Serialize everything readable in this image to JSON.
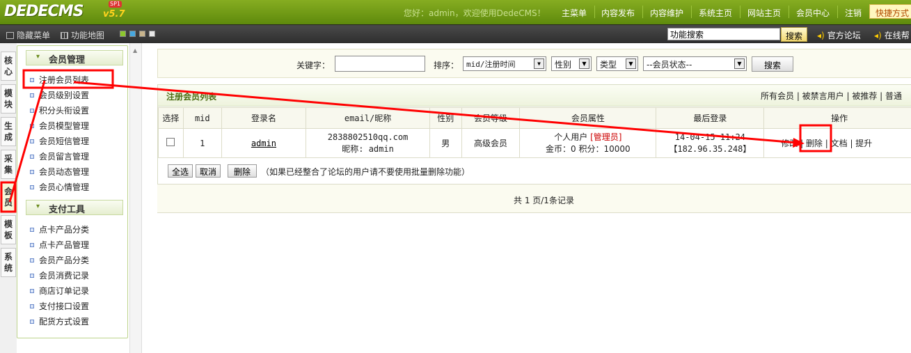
{
  "header": {
    "logo": "DEDECMS",
    "version": "v5.7",
    "edition": "SP1",
    "welcome": "您好：admin，欢迎使用DedeCMS！",
    "nav": [
      "主菜单",
      "内容发布",
      "内容维护",
      "系统主页",
      "网站主页",
      "会员中心",
      "注销"
    ],
    "shortcut": "快捷方式"
  },
  "toolbar": {
    "hide_menu": "隐藏菜单",
    "site_map": "功能地图",
    "skin_colors": [
      "#8ec82e",
      "#47a8e0",
      "#c8b48c",
      "#e8e8e8"
    ],
    "search_value": "功能搜索",
    "search_button": "搜索",
    "forum_link": "官方论坛",
    "help_link": "在线帮"
  },
  "vtabs": [
    {
      "label": "核\n心",
      "active": false
    },
    {
      "label": "模\n块",
      "active": false
    },
    {
      "label": "生\n成",
      "active": false
    },
    {
      "label": "采\n集",
      "active": false
    },
    {
      "label": "会\n员",
      "active": true
    },
    {
      "label": "模\n板",
      "active": false
    },
    {
      "label": "系\n统",
      "active": false
    }
  ],
  "sidebar": {
    "sections": [
      {
        "title": "会员管理",
        "items": [
          "注册会员列表",
          "会员级别设置",
          "积分头衔设置",
          "会员模型管理",
          "会员短信管理",
          "会员留言管理",
          "会员动态管理",
          "会员心情管理"
        ]
      },
      {
        "title": "支付工具",
        "items": [
          "点卡产品分类",
          "点卡产品管理",
          "会员产品分类",
          "会员消费记录",
          "商店订单记录",
          "支付接口设置",
          "配货方式设置"
        ]
      }
    ]
  },
  "search": {
    "keyword_label": "关键字：",
    "keyword_value": "",
    "sort_label": "排序：",
    "sort_value": "mid/注册时间",
    "gender_value": "性别",
    "type_value": "类型",
    "status_value": "--会员状态--",
    "button": "搜索"
  },
  "list": {
    "title": "注册会员列表",
    "filters": "所有会员 | 被禁言用户 | 被推荐 | 普通",
    "columns": [
      "选择",
      "mid",
      "登录名",
      "email/昵称",
      "性别",
      "会员等级",
      "会员属性",
      "最后登录",
      "操作"
    ],
    "rows": [
      {
        "mid": "1",
        "username": "admin",
        "email": "2838802510qq.com",
        "nickname": "昵称: admin",
        "gender": "男",
        "level": "高级会员",
        "attr_type": "个人用户",
        "attr_role": "[管理员]",
        "attr_points": "金币：0 积分：10000",
        "last_time": "14-04-15 11:24",
        "last_ip": "【182.96.35.248】",
        "actions": [
          "修改",
          "删除",
          "文档",
          "提升"
        ]
      }
    ],
    "select_all": "全选",
    "cancel": "取消",
    "delete": "删除",
    "delete_note": "（如果已经整合了论坛的用户请不要使用批量删除功能）",
    "pager": "共 1 页/1条记录"
  },
  "annotation_color": "#ff0000"
}
